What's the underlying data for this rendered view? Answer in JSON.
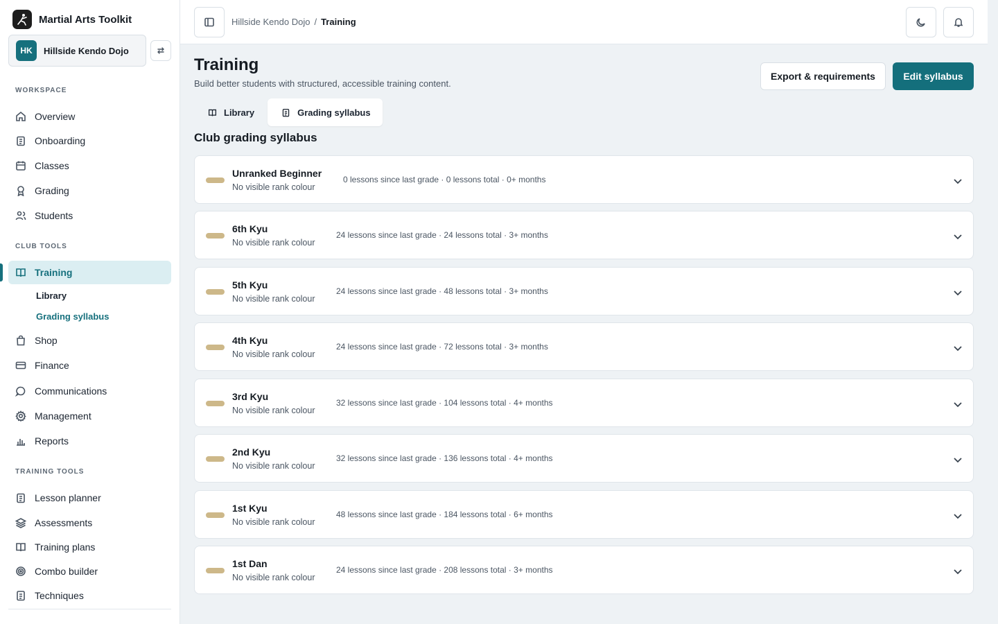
{
  "app": {
    "name": "Martial Arts Toolkit"
  },
  "club": {
    "initials": "HK",
    "name": "Hillside Kendo Dojo"
  },
  "sidebar": {
    "workspace_label": "WORKSPACE",
    "workspace": [
      {
        "label": "Overview",
        "icon": "home-icon"
      },
      {
        "label": "Onboarding",
        "icon": "clipboard-icon"
      },
      {
        "label": "Classes",
        "icon": "calendar-icon"
      },
      {
        "label": "Grading",
        "icon": "award-icon"
      },
      {
        "label": "Students",
        "icon": "users-icon"
      }
    ],
    "club_tools_label": "CLUB TOOLS",
    "club_tools": [
      {
        "label": "Training",
        "icon": "book-icon",
        "active": true
      },
      {
        "label": "Shop",
        "icon": "shopping-bag-icon"
      },
      {
        "label": "Finance",
        "icon": "credit-card-icon"
      },
      {
        "label": "Communications",
        "icon": "message-circle-icon"
      },
      {
        "label": "Management",
        "icon": "gear-icon"
      },
      {
        "label": "Reports",
        "icon": "bar-chart-icon"
      }
    ],
    "training_subitems": [
      {
        "label": "Library"
      },
      {
        "label": "Grading syllabus",
        "active": true
      }
    ],
    "training_tools_label": "TRAINING TOOLS",
    "training_tools": [
      {
        "label": "Lesson planner",
        "icon": "clipboard-list-icon"
      },
      {
        "label": "Assessments",
        "icon": "layers-icon"
      },
      {
        "label": "Training plans",
        "icon": "book-open-icon"
      },
      {
        "label": "Combo builder",
        "icon": "target-icon"
      },
      {
        "label": "Techniques",
        "icon": "file-text-icon"
      }
    ]
  },
  "breadcrumb": {
    "parent": "Hillside Kendo Dojo",
    "separator": "/",
    "current": "Training"
  },
  "page": {
    "title": "Training",
    "subtitle": "Build better students with structured, accessible training content.",
    "export_label": "Export & requirements",
    "edit_label": "Edit syllabus",
    "tabs": [
      {
        "label": "Library",
        "active": false
      },
      {
        "label": "Grading syllabus",
        "active": true
      }
    ],
    "section_title": "Club grading syllabus"
  },
  "grades": [
    {
      "name": "Unranked Beginner",
      "colour": "No visible rank colour",
      "requirements": "0 lessons since last grade · 0 lessons total · 0+ months"
    },
    {
      "name": "6th Kyu",
      "colour": "No visible rank colour",
      "requirements": "24 lessons since last grade · 24 lessons total · 3+ months"
    },
    {
      "name": "5th Kyu",
      "colour": "No visible rank colour",
      "requirements": "24 lessons since last grade · 48 lessons total · 3+ months"
    },
    {
      "name": "4th Kyu",
      "colour": "No visible rank colour",
      "requirements": "24 lessons since last grade · 72 lessons total · 3+ months"
    },
    {
      "name": "3rd Kyu",
      "colour": "No visible rank colour",
      "requirements": "32 lessons since last grade · 104 lessons total · 4+ months"
    },
    {
      "name": "2nd Kyu",
      "colour": "No visible rank colour",
      "requirements": "32 lessons since last grade · 136 lessons total · 4+ months"
    },
    {
      "name": "1st Kyu",
      "colour": "No visible rank colour",
      "requirements": "48 lessons since last grade · 184 lessons total · 6+ months"
    },
    {
      "name": "1st Dan",
      "colour": "No visible rank colour",
      "requirements": "24 lessons since last grade · 208 lessons total · 3+ months"
    }
  ],
  "colors": {
    "accent": "#146f7c",
    "rank_pill": "#cdb889",
    "active_nav_bg": "#dbeef2"
  }
}
